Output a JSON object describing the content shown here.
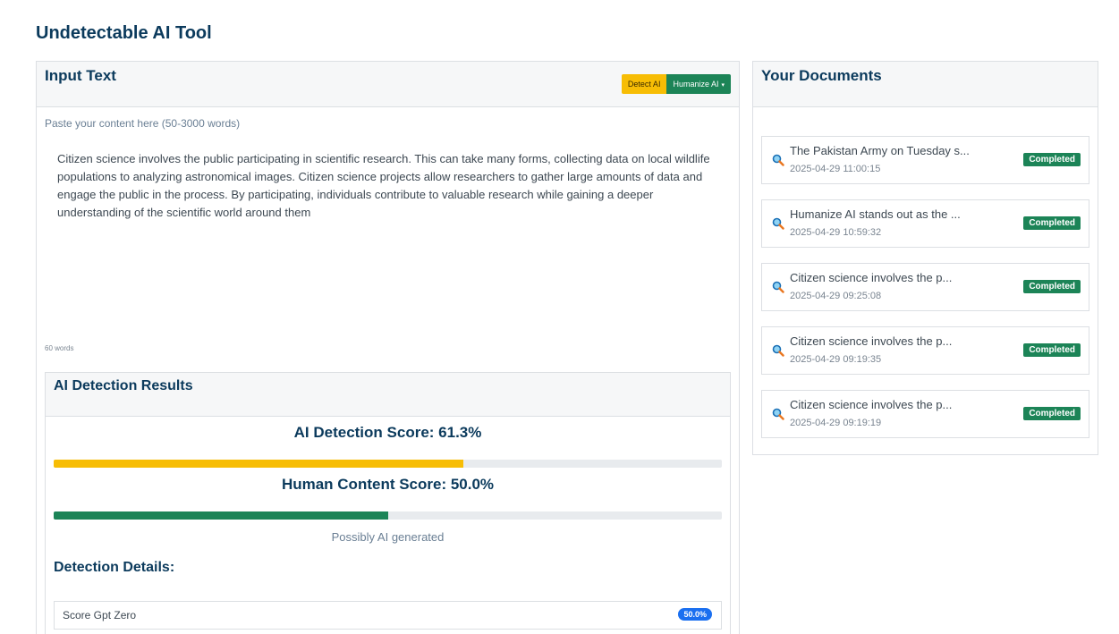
{
  "page": {
    "title": "Undetectable AI Tool"
  },
  "input": {
    "title": "Input Text",
    "detect_label": "Detect AI",
    "humanize_label": "Humanize AI",
    "placeholder_label": "Paste your content here (50-3000 words)",
    "text": "Citizen science involves the public participating in scientific research. This can take many forms, collecting data on local wildlife populations to analyzing astronomical images. Citizen science projects allow researchers to gather large amounts of data and engage the public in the process. By participating, individuals contribute to valuable research while gaining a deeper understanding of the scientific world around them",
    "word_count": "60 words"
  },
  "results": {
    "title": "AI Detection Results",
    "ai_score_text": "AI Detection Score: 61.3%",
    "ai_score_value": 61.3,
    "ai_color": "#f7bd05",
    "human_score_text": "Human Content Score: 50.0%",
    "human_score_value": 50.0,
    "human_color": "#1c8457",
    "verdict": "Possibly AI generated",
    "details_title": "Detection Details:",
    "details": [
      {
        "label": "Score Gpt Zero",
        "value": "50.0%"
      }
    ]
  },
  "documents": {
    "title": "Your Documents",
    "status_color": "#1c8457",
    "items": [
      {
        "title": "The Pakistan Army on Tuesday s...",
        "date": "2025-04-29 11:00:15",
        "status": "Completed",
        "icon": "magnifier-icon"
      },
      {
        "title": "Humanize AI stands out as the ...",
        "date": "2025-04-29 10:59:32",
        "status": "Completed",
        "icon": "magnifier-icon"
      },
      {
        "title": "Citizen science involves the p...",
        "date": "2025-04-29 09:25:08",
        "status": "Completed",
        "icon": "magnifier-icon"
      },
      {
        "title": "Citizen science involves the p...",
        "date": "2025-04-29 09:19:35",
        "status": "Completed",
        "icon": "magnifier-icon"
      },
      {
        "title": "Citizen science involves the p...",
        "date": "2025-04-29 09:19:19",
        "status": "Completed",
        "icon": "magnifier-icon"
      }
    ]
  }
}
